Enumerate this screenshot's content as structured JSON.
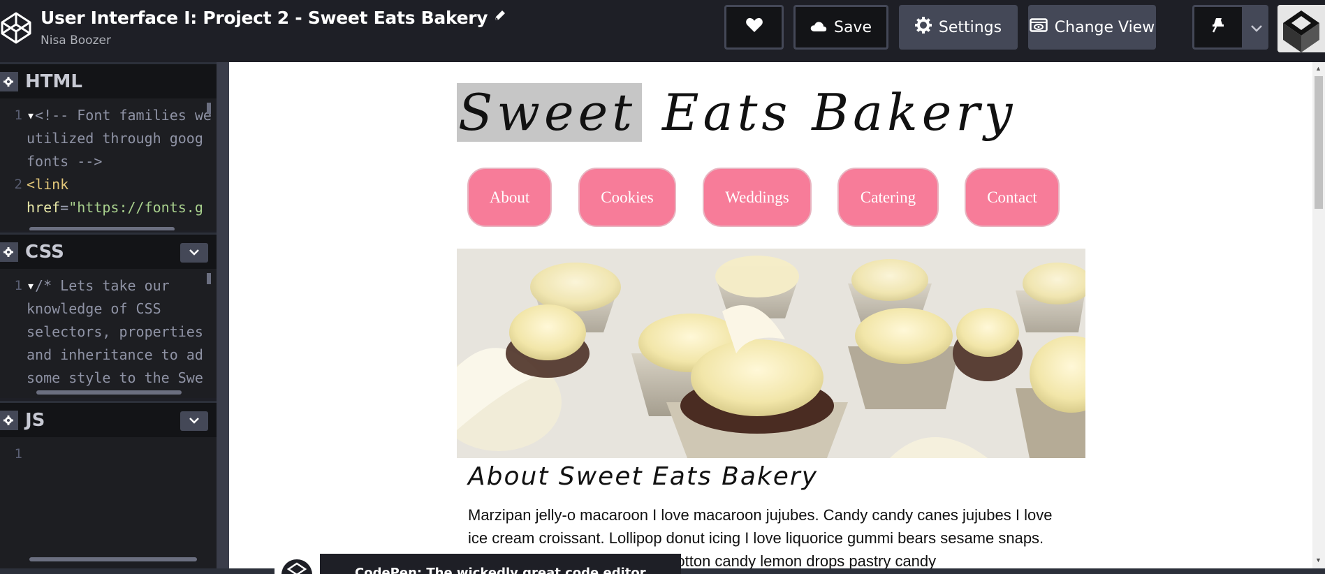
{
  "header": {
    "pen_title": "User Interface I: Project 2 - Sweet Eats Bakery",
    "author": "Nisa Boozer",
    "buttons": {
      "save": "Save",
      "settings": "Settings",
      "change_view": "Change View"
    },
    "icons": [
      "codepen-logo-icon",
      "pencil-icon",
      "heart-icon",
      "cloud-icon",
      "gear-icon",
      "change-view-icon",
      "pin-icon",
      "chevron-down-icon"
    ]
  },
  "editors": {
    "html": {
      "name": "HTML",
      "lines": [
        {
          "num": "1",
          "fold": true,
          "parts": [
            {
              "t": "<!-- Font families we",
              "c": "c-comment"
            }
          ]
        },
        {
          "num": "",
          "fold": false,
          "parts": [
            {
              "t": "utilized through goog",
              "c": "c-comment"
            }
          ]
        },
        {
          "num": "",
          "fold": false,
          "parts": [
            {
              "t": "fonts -->",
              "c": "c-comment"
            }
          ]
        },
        {
          "num": "2",
          "fold": false,
          "parts": [
            {
              "t": "<link",
              "c": "c-tag"
            }
          ]
        },
        {
          "num": "",
          "fold": false,
          "parts": [
            {
              "t": "href",
              "c": "c-attr"
            },
            {
              "t": "=",
              "c": "code-text"
            },
            {
              "t": "\"https://fonts.g",
              "c": "c-str"
            }
          ]
        }
      ]
    },
    "css": {
      "name": "CSS",
      "lines": [
        {
          "num": "1",
          "fold": true,
          "parts": [
            {
              "t": "/* Lets take our",
              "c": "c-comment"
            }
          ]
        },
        {
          "num": "",
          "fold": false,
          "parts": [
            {
              "t": "knowledge of CSS",
              "c": "c-comment"
            }
          ]
        },
        {
          "num": "",
          "fold": false,
          "parts": [
            {
              "t": "selectors, properties",
              "c": "c-comment"
            }
          ]
        },
        {
          "num": "",
          "fold": false,
          "parts": [
            {
              "t": "and inheritance to ad",
              "c": "c-comment"
            }
          ]
        },
        {
          "num": "",
          "fold": false,
          "parts": [
            {
              "t": "some style to the Swe",
              "c": "c-comment"
            }
          ]
        }
      ]
    },
    "js": {
      "name": "JS",
      "lines": [
        {
          "num": "1",
          "fold": false,
          "parts": [
            {
              "t": "",
              "c": "code-text"
            }
          ]
        }
      ]
    }
  },
  "preview": {
    "site_title_selected": "Sweet",
    "site_title_rest": "Eats Bakery",
    "nav": [
      "About",
      "Cookies",
      "Weddings",
      "Catering",
      "Contact"
    ],
    "hero_alt": "cupcakes",
    "about_heading": "About Sweet Eats Bakery",
    "about_text": "Marzipan jelly-o macaroon I love macaroon jujubes. Candy candy canes jujubes I love ice cream croissant. Lollipop donut icing I love liquorice gummi bears sesame snaps. Dessert jelly beans apple pie cotton candy lemon drops pastry candy"
  },
  "toast": {
    "text": "CodePen: The wickedly great code editor"
  },
  "colors": {
    "nav_pink": "#f77c99",
    "editor_bg": "#1d1e22",
    "header_bg": "#1e1f26",
    "button_gray": "#444857"
  }
}
